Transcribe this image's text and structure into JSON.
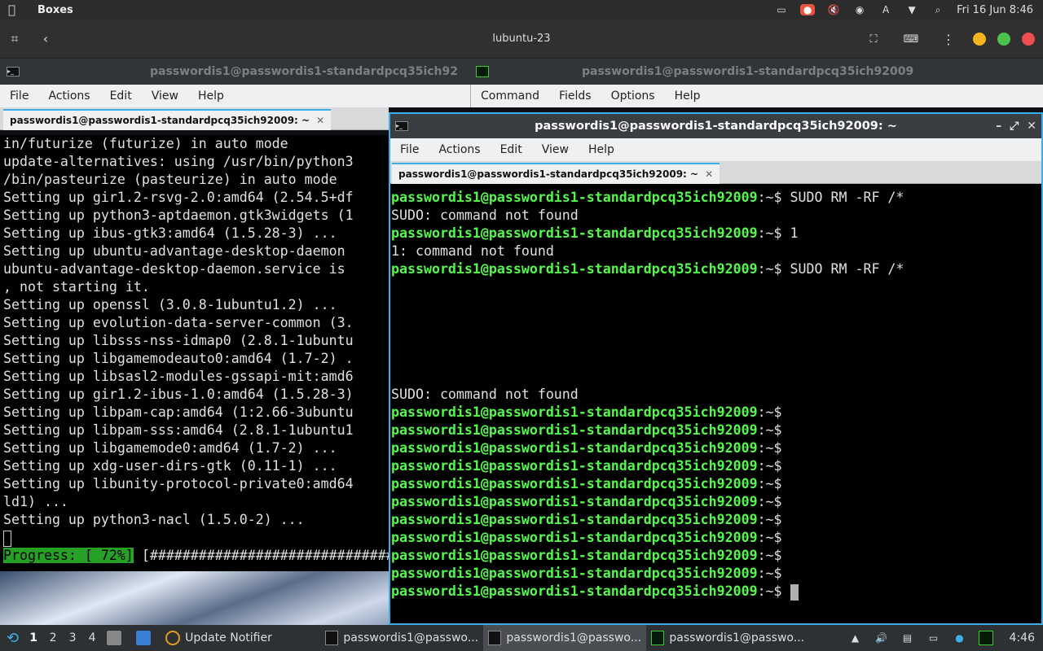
{
  "host": {
    "app_name": "Boxes",
    "clock": "Fri 16 Jun  8:46",
    "boxes_title": "lubuntu-23"
  },
  "left_window": {
    "title": "passwordis1@passwordis1-standardpcq35ich92",
    "menus": [
      "File",
      "Actions",
      "Edit",
      "View",
      "Help"
    ],
    "tab_label": "passwordis1@passwordis1-standardpcq35ich92009: ~",
    "lines": [
      "in/futurize (futurize) in auto mode",
      "update-alternatives: using /usr/bin/python3",
      "/bin/pasteurize (pasteurize) in auto mode",
      "Setting up gir1.2-rsvg-2.0:amd64 (2.54.5+df",
      "Setting up python3-aptdaemon.gtk3widgets (1",
      "Setting up ibus-gtk3:amd64 (1.5.28-3) ...",
      "Setting up ubuntu-advantage-desktop-daemon",
      "ubuntu-advantage-desktop-daemon.service is",
      ", not starting it.",
      "Setting up openssl (3.0.8-1ubuntu1.2) ...",
      "Setting up evolution-data-server-common (3.",
      "Setting up libsss-nss-idmap0 (2.8.1-1ubuntu",
      "Setting up libgamemodeauto0:amd64 (1.7-2) .",
      "Setting up libsasl2-modules-gssapi-mit:amd6",
      "Setting up gir1.2-ibus-1.0:amd64 (1.5.28-3)",
      "Setting up libpam-cap:amd64 (1:2.66-3ubuntu",
      "Setting up libpam-sss:amd64 (2.8.1-1ubuntu1",
      "Setting up libgamemode0:amd64 (1.7-2) ...",
      "Setting up xdg-user-dirs-gtk (0.11-1) ...",
      "Setting up libunity-protocol-private0:amd64",
      "ld1) ...",
      "Setting up python3-nacl (1.5.0-2) ..."
    ],
    "progress_label": "Progress: [ 72%]",
    "progress_bar": " [##############################"
  },
  "back_window": {
    "title": "passwordis1@passwordis1-standardpcq35ich92009",
    "menus": [
      "Command",
      "Fields",
      "Options",
      "Help"
    ]
  },
  "right_window": {
    "title": "passwordis1@passwordis1-standardpcq35ich92009: ~",
    "menus": [
      "File",
      "Actions",
      "Edit",
      "View",
      "Help"
    ],
    "tab_label": "passwordis1@passwordis1-standardpcq35ich92009: ~",
    "prompt_user": "passwordis1@passwordis1-standardpcq35ich92009",
    "prompt_suffix": ":~$",
    "session": [
      {
        "cmd": " SUDO RM -RF /*"
      },
      {
        "out": "SUDO: command not found"
      },
      {
        "cmd": " 1"
      },
      {
        "out": "1: command not found"
      },
      {
        "cmd": " SUDO RM -RF /*"
      },
      {
        "out": ""
      },
      {
        "out": ""
      },
      {
        "out": ""
      },
      {
        "out": ""
      },
      {
        "out": ""
      },
      {
        "out": ""
      },
      {
        "out": "SUDO: command not found"
      },
      {
        "cmd": ""
      },
      {
        "cmd": ""
      },
      {
        "cmd": ""
      },
      {
        "cmd": ""
      },
      {
        "cmd": ""
      },
      {
        "cmd": ""
      },
      {
        "cmd": ""
      },
      {
        "cmd": ""
      },
      {
        "cmd": ""
      },
      {
        "cmd": ""
      },
      {
        "cmd": " ",
        "cursor": true
      }
    ]
  },
  "taskbar": {
    "workspaces": [
      "1",
      "2",
      "3",
      "4"
    ],
    "items": [
      {
        "label": "Update Notifier",
        "icon": "update-notifier-icon"
      },
      {
        "label": "passwordis1@passwo...",
        "icon": "terminal-icon"
      },
      {
        "label": "passwordis1@passwo...",
        "icon": "terminal-icon",
        "active": true
      },
      {
        "label": "passwordis1@passwo...",
        "icon": "system-monitor-icon"
      }
    ],
    "clock": "4:46"
  },
  "colors": {
    "prompt_green": "#54f84b",
    "accent_blue": "#3daee9",
    "progress_green": "#26a025"
  }
}
